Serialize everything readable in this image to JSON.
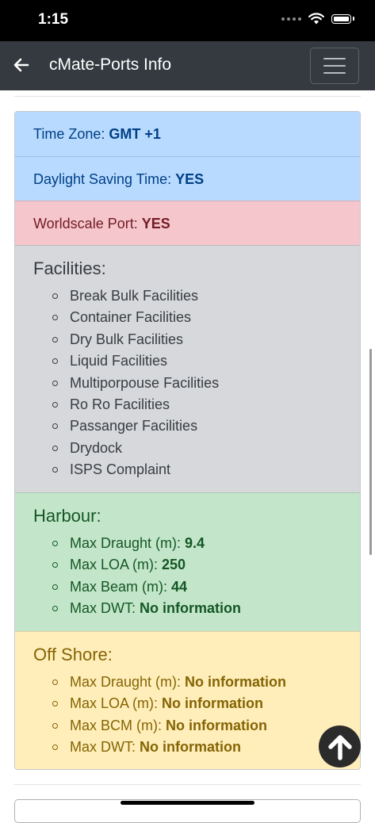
{
  "status_bar": {
    "time": "1:15"
  },
  "nav": {
    "title": "cMate-Ports Info"
  },
  "info": {
    "time_zone": {
      "label": "Time Zone:",
      "value": "GMT +1"
    },
    "dst": {
      "label": "Daylight Saving Time:",
      "value": "YES"
    },
    "worldscale": {
      "label": "Worldscale Port:",
      "value": "YES"
    }
  },
  "facilities": {
    "title": "Facilities:",
    "items": [
      "Break Bulk Facilities",
      "Container Facilities",
      "Dry Bulk Facilities",
      "Liquid Facilities",
      "Multiporpouse Facilities",
      "Ro Ro Facilities",
      "Passanger Facilities",
      "Drydock",
      "ISPS Complaint"
    ]
  },
  "harbour": {
    "title": "Harbour:",
    "items": [
      {
        "label": "Max Draught (m):",
        "value": "9.4"
      },
      {
        "label": "Max LOA (m):",
        "value": "250"
      },
      {
        "label": "Max Beam (m):",
        "value": "44"
      },
      {
        "label": "Max DWT:",
        "value": "No information"
      }
    ]
  },
  "offshore": {
    "title": "Off Shore:",
    "items": [
      {
        "label": "Max Draught (m):",
        "value": "No information"
      },
      {
        "label": "Max LOA (m):",
        "value": "No information"
      },
      {
        "label": "Max BCM (m):",
        "value": "No information"
      },
      {
        "label": "Max DWT:",
        "value": "No information"
      }
    ]
  },
  "colors": {
    "navbar": "#343a40",
    "info_blue": "#b8daff",
    "danger_red": "#f5c6cb",
    "secondary_gray": "#d6d8db",
    "success_green": "#c3e6cb",
    "warning_yellow": "#ffeeba"
  },
  "icons": {
    "back": "arrow-left-icon",
    "menu": "hamburger-menu-icon",
    "scroll_top": "arrow-up-circle-icon"
  }
}
